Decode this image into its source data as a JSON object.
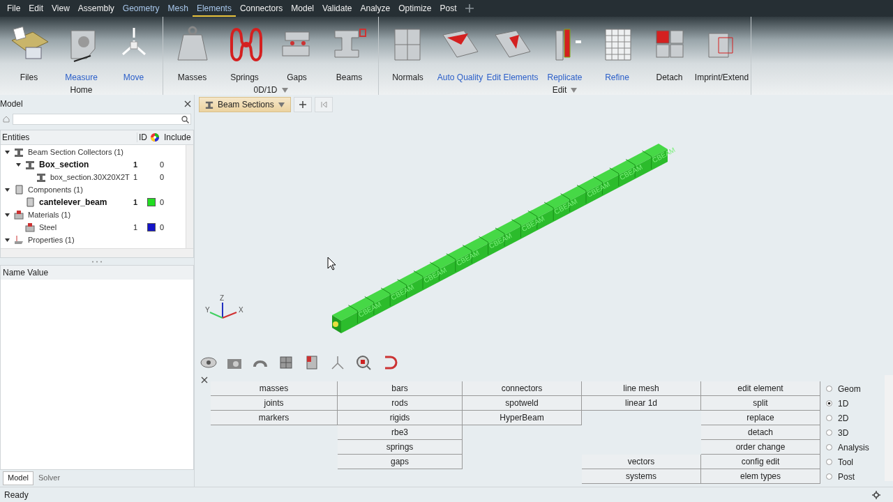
{
  "menu": [
    {
      "label": "File",
      "selected": false,
      "accent": false
    },
    {
      "label": "Edit",
      "selected": false,
      "accent": false
    },
    {
      "label": "View",
      "selected": false,
      "accent": false
    },
    {
      "label": "Assembly",
      "selected": false,
      "accent": false
    },
    {
      "label": "Geometry",
      "selected": false,
      "accent": true
    },
    {
      "label": "Mesh",
      "selected": false,
      "accent": true
    },
    {
      "label": "Elements",
      "selected": true,
      "accent": true
    },
    {
      "label": "Connectors",
      "selected": false,
      "accent": false
    },
    {
      "label": "Model",
      "selected": false,
      "accent": false
    },
    {
      "label": "Validate",
      "selected": false,
      "accent": false
    },
    {
      "label": "Analyze",
      "selected": false,
      "accent": false
    },
    {
      "label": "Optimize",
      "selected": false,
      "accent": false
    },
    {
      "label": "Post",
      "selected": false,
      "accent": false
    }
  ],
  "ribbon": {
    "groups": [
      {
        "label": "Home",
        "has_menu": false,
        "tools": [
          {
            "label": "Files",
            "accent": false
          },
          {
            "label": "Measure",
            "accent": true
          },
          {
            "label": "Move",
            "accent": true
          }
        ]
      },
      {
        "label": "0D/1D",
        "has_menu": true,
        "tools": [
          {
            "label": "Masses",
            "accent": false
          },
          {
            "label": "Springs",
            "accent": false
          },
          {
            "label": "Gaps",
            "accent": false
          },
          {
            "label": "Beams",
            "accent": false
          }
        ]
      },
      {
        "label": "Edit",
        "has_menu": true,
        "tools": [
          {
            "label": "Normals",
            "accent": false
          },
          {
            "label": "Auto Quality",
            "accent": true
          },
          {
            "label": "Edit Elements",
            "accent": true
          },
          {
            "label": "Replicate",
            "accent": true
          },
          {
            "label": "Refine",
            "accent": true
          },
          {
            "label": "Detach",
            "accent": false
          },
          {
            "label": "Imprint/Extend",
            "accent": false
          }
        ]
      }
    ]
  },
  "model_panel": {
    "title": "Model",
    "columns": [
      "Entities",
      "ID",
      "Include"
    ],
    "tree": [
      {
        "label": "Beam Section Collectors (1)",
        "bold": false,
        "expanded": true,
        "children": [
          {
            "label": "Box_section",
            "bold": true,
            "expanded": true,
            "id": "1",
            "include": "0",
            "children": [
              {
                "label": "box_section.30X20X2T",
                "bold": false,
                "id": "1",
                "include": "0"
              }
            ]
          }
        ]
      },
      {
        "label": "Components (1)",
        "bold": false,
        "expanded": true,
        "children": [
          {
            "label": "cantelever_beam",
            "bold": true,
            "id": "1",
            "color": "#22dd22",
            "include": "0"
          }
        ]
      },
      {
        "label": "Materials (1)",
        "bold": false,
        "expanded": true,
        "children": [
          {
            "label": "Steel",
            "bold": false,
            "id": "1",
            "color": "#1414c8",
            "include": "0"
          }
        ]
      },
      {
        "label": "Properties (1)",
        "bold": false,
        "expanded": true
      }
    ],
    "properties_header": "Name Value"
  },
  "bottom_tabs": [
    {
      "label": "Model",
      "selected": true
    },
    {
      "label": "Solver",
      "selected": false
    }
  ],
  "viewport": {
    "browser_dropdown": "Beam Sections",
    "element_labels": [
      "CBEAM",
      "CBEAM",
      "CBEAM",
      "CBEAM",
      "CBEAM",
      "CBEAM",
      "CBEAM",
      "CBEAM",
      "CBEAM",
      "CBEAM"
    ],
    "triad": [
      "Z",
      "Y",
      "X"
    ]
  },
  "panel": {
    "columns": [
      {
        "top": [
          "masses",
          "joints",
          "markers"
        ]
      },
      {
        "top": [
          "bars",
          "rods",
          "rigids",
          "rbe3",
          "springs",
          "gaps"
        ]
      },
      {
        "top": [
          "connectors",
          "spotweld",
          "HyperBeam"
        ]
      },
      {
        "top": [
          "line mesh",
          "linear 1d"
        ],
        "bottom": [
          "vectors",
          "systems"
        ]
      },
      {
        "top": [
          "edit element",
          "split",
          "replace",
          "detach",
          "order change",
          "config edit",
          "elem types"
        ]
      }
    ],
    "modes": [
      {
        "label": "Geom",
        "selected": false
      },
      {
        "label": "1D",
        "selected": true
      },
      {
        "label": "2D",
        "selected": false
      },
      {
        "label": "3D",
        "selected": false
      },
      {
        "label": "Analysis",
        "selected": false
      },
      {
        "label": "Tool",
        "selected": false
      },
      {
        "label": "Post",
        "selected": false
      }
    ]
  },
  "status_bar": "Ready"
}
